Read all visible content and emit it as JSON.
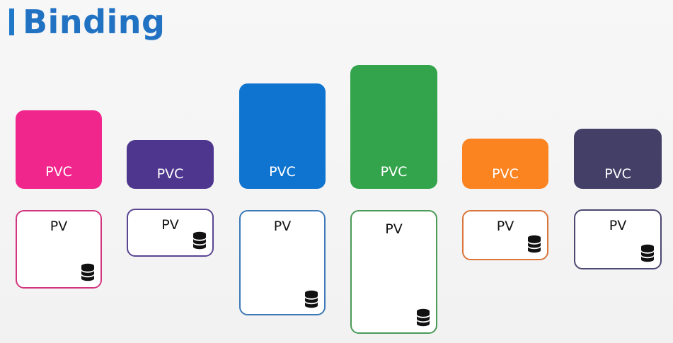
{
  "title": "Binding",
  "pairs": [
    {
      "pvc_label": "PVC",
      "pv_label": "PV",
      "pvc_color": "#f0268c",
      "pv_border": "#d1357f",
      "pv_icon": "database-icon"
    },
    {
      "pvc_label": "PVC",
      "pv_label": "PV",
      "pvc_color": "#4e368f",
      "pv_border": "#5a4592",
      "pv_icon": "database-icon"
    },
    {
      "pvc_label": "PVC",
      "pv_label": "PV",
      "pvc_color": "#0f74cf",
      "pv_border": "#3c79b6",
      "pv_icon": "database-icon"
    },
    {
      "pvc_label": "PVC",
      "pv_label": "PV",
      "pvc_color": "#33a44b",
      "pv_border": "#4a9a58",
      "pv_icon": "database-icon"
    },
    {
      "pvc_label": "PVC",
      "pv_label": "PV",
      "pvc_color": "#fb8320",
      "pv_border": "#d9743a",
      "pv_icon": "database-icon"
    },
    {
      "pvc_label": "PVC",
      "pv_label": "PV",
      "pvc_color": "#433f66",
      "pv_border": "#4b4870",
      "pv_icon": "database-icon"
    }
  ]
}
